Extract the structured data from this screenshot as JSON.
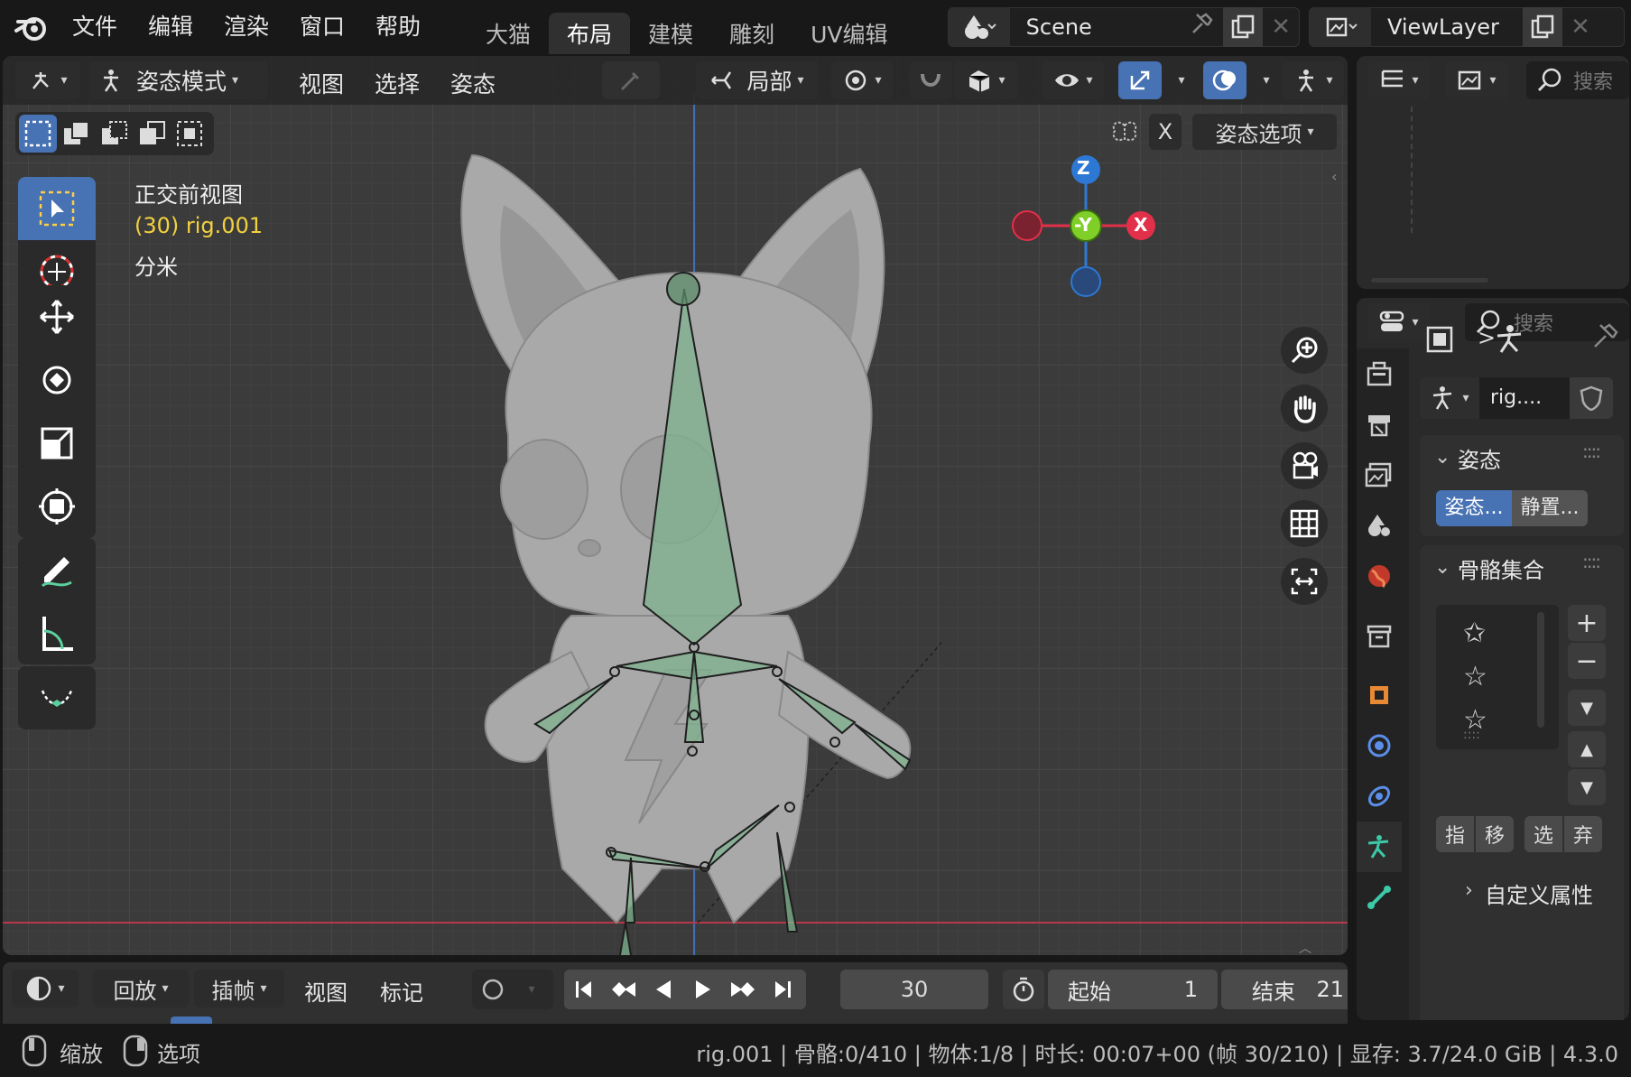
{
  "app": {
    "menu": [
      "文件",
      "编辑",
      "渲染",
      "窗口",
      "帮助"
    ],
    "workspaces": [
      {
        "label": "大猫",
        "active": false
      },
      {
        "label": "布局",
        "active": true
      },
      {
        "label": "建模",
        "active": false
      },
      {
        "label": "雕刻",
        "active": false
      },
      {
        "label": "UV编辑",
        "active": false
      }
    ],
    "scene": "Scene",
    "view_layer": "ViewLayer"
  },
  "viewport_header": {
    "mode": "姿态模式",
    "menus": [
      "视图",
      "选择",
      "姿态"
    ],
    "transform_orientation": "局部",
    "pose_options": "姿态选项",
    "mirror_axis": "X"
  },
  "viewport_overlay": {
    "view_name": "正交前视图",
    "object_info": "(30) rig.001",
    "units": "分米",
    "gizmo_axes": {
      "z": "Z",
      "y": "-Y",
      "x": "X"
    }
  },
  "outliner": {
    "search_placeholder": "搜索"
  },
  "properties": {
    "search_placeholder": "搜索",
    "breadcrumb_arrow": ">",
    "armature_name": "rig....",
    "pose_section": "姿态",
    "pose_buttons": [
      "姿态...",
      "静置..."
    ],
    "bone_collections_section": "骨骼集合",
    "bone_collection_buttons": [
      "指",
      "移",
      "选",
      "弃"
    ],
    "custom_props_section": "自定义属性"
  },
  "timeline": {
    "menus": [
      "回放",
      "插帧"
    ],
    "view_menus": [
      "视图",
      "标记"
    ],
    "current_frame": "30",
    "start_label": "起始",
    "start_value": "1",
    "end_label": "结束",
    "end_value": "21"
  },
  "statusbar": {
    "hint_zoom": "缩放",
    "hint_options": "选项",
    "info": "rig.001 | 骨骼:0/410 | 物体:1/8 | 时长: 00:07+00 (帧 30/210) | 显存: 3.7/24.0 GiB | 4.3.0"
  },
  "colors": {
    "accent": "#4772b3",
    "bone_fill": "#7fb38f",
    "axis_x": "#e2304a",
    "axis_y": "#7fcf28",
    "axis_z": "#2d78d4",
    "info_yellow": "#f2d13f"
  }
}
